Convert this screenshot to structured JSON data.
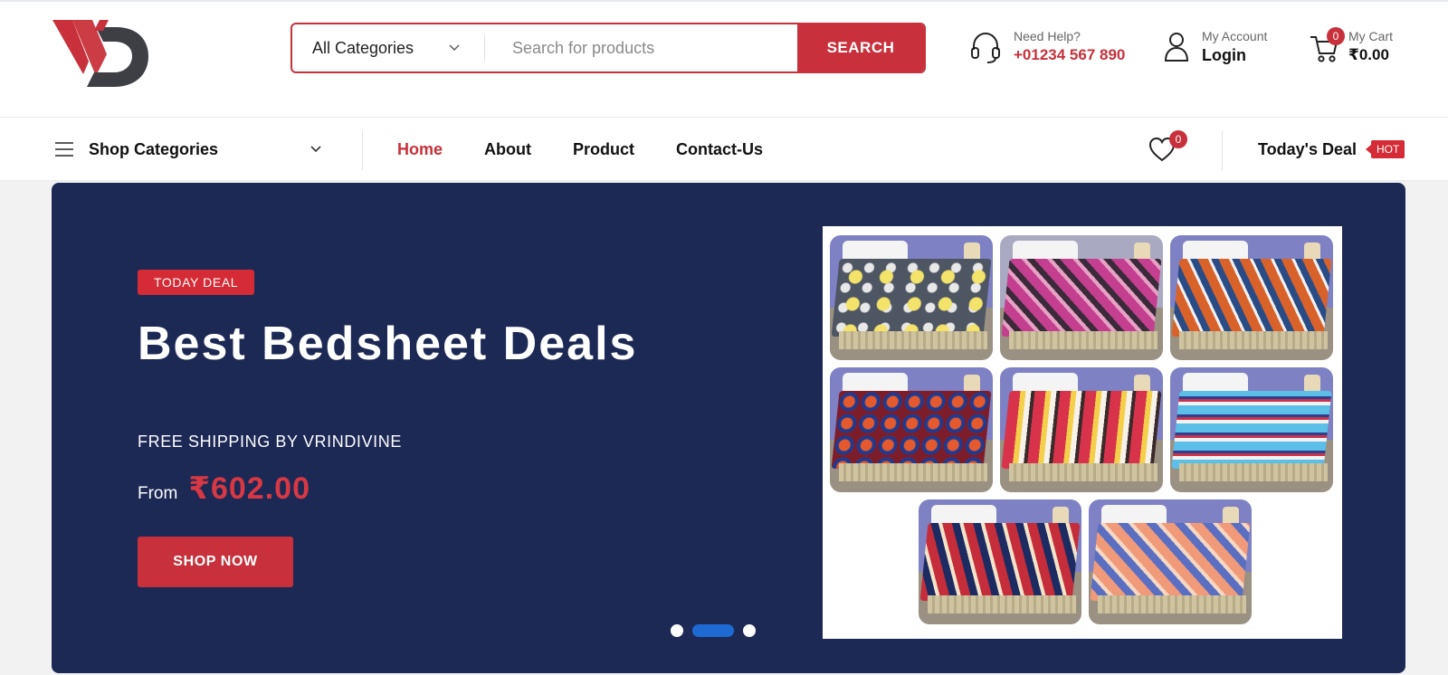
{
  "header": {
    "search": {
      "category": "All Categories",
      "placeholder": "Search for products",
      "button": "SEARCH"
    },
    "help": {
      "label": "Need Help?",
      "phone": "+01234 567 890"
    },
    "account": {
      "label": "My Account",
      "action": "Login"
    },
    "cart": {
      "label": "My Cart",
      "total": "₹0.00",
      "count": "0"
    }
  },
  "nav": {
    "shop_categories": "Shop Categories",
    "links": [
      {
        "label": "Home",
        "active": true
      },
      {
        "label": "About"
      },
      {
        "label": "Product"
      },
      {
        "label": "Contact-Us"
      }
    ],
    "wishlist_count": "0",
    "deal_label": "Today's Deal",
    "deal_badge": "HOT"
  },
  "hero": {
    "tag": "TODAY DEAL",
    "title": "Best Bedsheet Deals",
    "subtitle": "FREE SHIPPING BY VRINDIVINE",
    "price_prefix": "From",
    "price": "₹602.00",
    "button": "SHOP NOW",
    "slides": 3,
    "active_slide": 2
  },
  "colors": {
    "accent": "#c8313b",
    "hero_bg": "#1c2955",
    "dot_active": "#1e6ad3"
  }
}
